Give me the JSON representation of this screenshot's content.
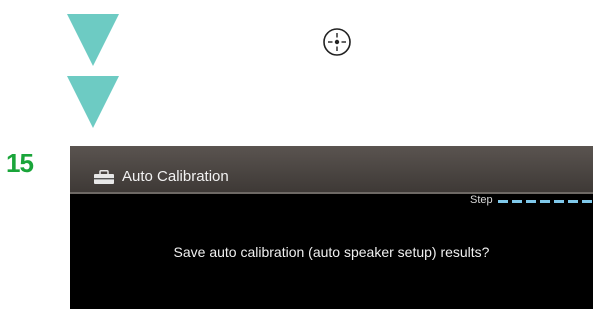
{
  "colors": {
    "arrow": "#6dcbc3",
    "step_number": "#1aa53a",
    "screen_bg": "#000000",
    "titlebar": "#4a4542",
    "progress_dash": "#7fc8ea"
  },
  "icons": [
    "down-arrow-icon",
    "down-arrow-icon",
    "enter-button-icon",
    "toolbox-icon"
  ],
  "step_number": "15",
  "screen": {
    "title": "Auto Calibration",
    "step_label": "Step",
    "message": "Save auto calibration (auto speaker setup) results?"
  }
}
